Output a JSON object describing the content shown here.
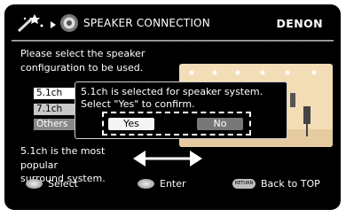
{
  "header": {
    "title": "SPEAKER CONNECTION",
    "brand": "DENON",
    "icons": [
      "magic-wand-icon",
      "arrow-right-icon",
      "speaker-icon"
    ]
  },
  "instruction": {
    "line1": "Please select the speaker",
    "line2": "configuration to be used."
  },
  "options": [
    {
      "label": "5.1ch",
      "state": "selected"
    },
    {
      "label": "7.1ch",
      "state": "normal"
    },
    {
      "label": "Others",
      "state": "normal"
    }
  ],
  "description": {
    "line1": "5.1ch is the most popular",
    "line2": "surround system."
  },
  "dialog": {
    "line1": "5.1ch is selected for speaker system.",
    "line2": "Select \"Yes\" to confirm.",
    "yes_label": "Yes",
    "no_label": "No",
    "focused": "Yes"
  },
  "footer": {
    "select_label": "Select",
    "enter_label": "Enter",
    "return_key_label": "RETURN",
    "back_label": "Back to TOP"
  },
  "colors": {
    "background": "#000000",
    "text": "#ffffff",
    "room": "#f3ddb7",
    "selected_option": "#ffffff"
  }
}
